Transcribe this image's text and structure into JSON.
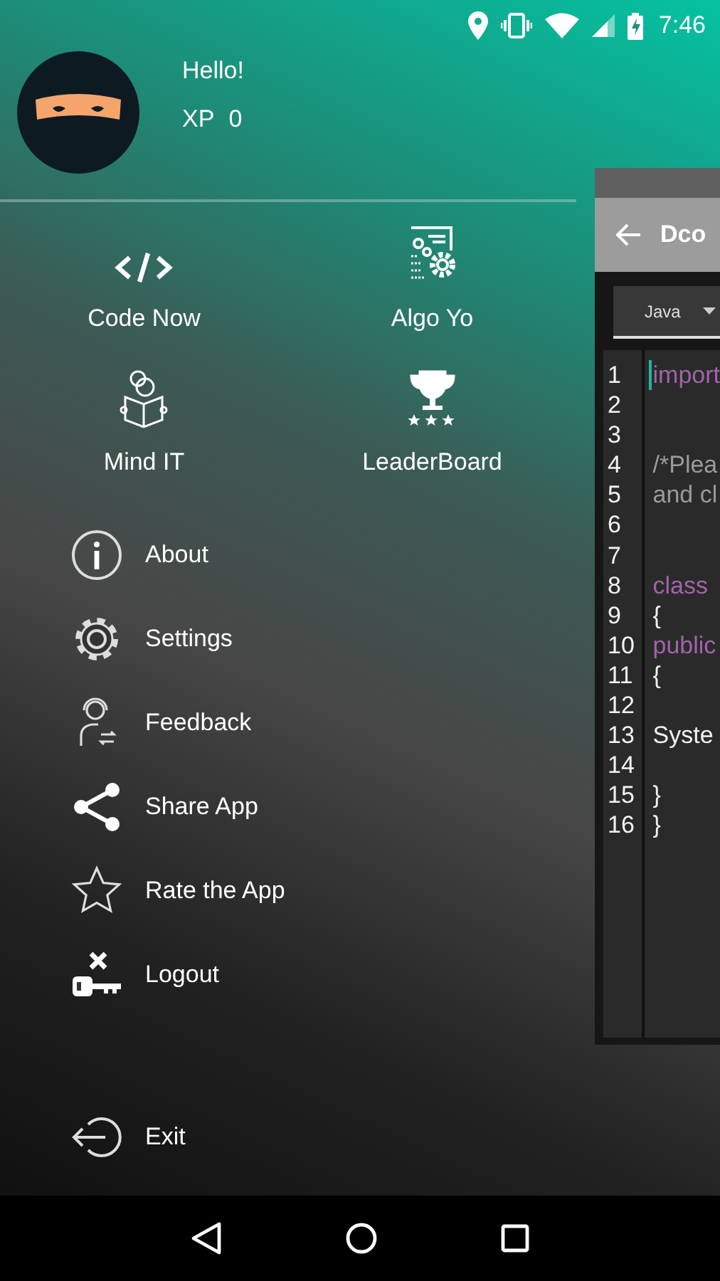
{
  "status_bar": {
    "time": "7:46"
  },
  "profile": {
    "greeting": "Hello!",
    "xp_label": "XP",
    "xp_value": "0"
  },
  "tiles": [
    {
      "label": "Code Now",
      "kind": "code"
    },
    {
      "label": "Algo Yo",
      "kind": "algo"
    },
    {
      "label": "Mind IT",
      "kind": "reader"
    },
    {
      "label": "LeaderBoard",
      "kind": "trophy"
    }
  ],
  "menu": [
    {
      "label": "About",
      "kind": "info"
    },
    {
      "label": "Settings",
      "kind": "gear"
    },
    {
      "label": "Feedback",
      "kind": "support"
    },
    {
      "label": "Share App",
      "kind": "share"
    },
    {
      "label": "Rate the App",
      "kind": "star"
    },
    {
      "label": "Logout",
      "kind": "key"
    }
  ],
  "exit": {
    "label": "Exit"
  },
  "editor": {
    "title": "Dco",
    "language": "Java",
    "lines": [
      {
        "number": "1",
        "text": "import",
        "kind": "keyword",
        "cursor": true
      },
      {
        "number": "2",
        "cursor": false
      },
      {
        "number": "3",
        "cursor": false
      },
      {
        "number": "4",
        "text": "/*Plea",
        "kind": "comment",
        "cursor": false
      },
      {
        "number": "5",
        "text": "and cl",
        "kind": "comment",
        "cursor": false
      },
      {
        "number": "6",
        "cursor": false
      },
      {
        "number": "7",
        "cursor": false
      },
      {
        "number": "8",
        "text": "class",
        "kind": "keyword",
        "cursor": false
      },
      {
        "number": "9",
        "text": "{",
        "kind": "plain",
        "cursor": false
      },
      {
        "number": "10",
        "text": "public",
        "kind": "keyword",
        "cursor": false
      },
      {
        "number": "11",
        "text": "{",
        "kind": "plain",
        "cursor": false
      },
      {
        "number": "12",
        "cursor": false
      },
      {
        "number": "13",
        "text": "Syste",
        "kind": "plain",
        "cursor": false
      },
      {
        "number": "14",
        "cursor": false
      },
      {
        "number": "15",
        "text": "}",
        "kind": "plain",
        "cursor": false
      },
      {
        "number": "16",
        "text": "}",
        "kind": "plain",
        "cursor": false
      }
    ]
  }
}
